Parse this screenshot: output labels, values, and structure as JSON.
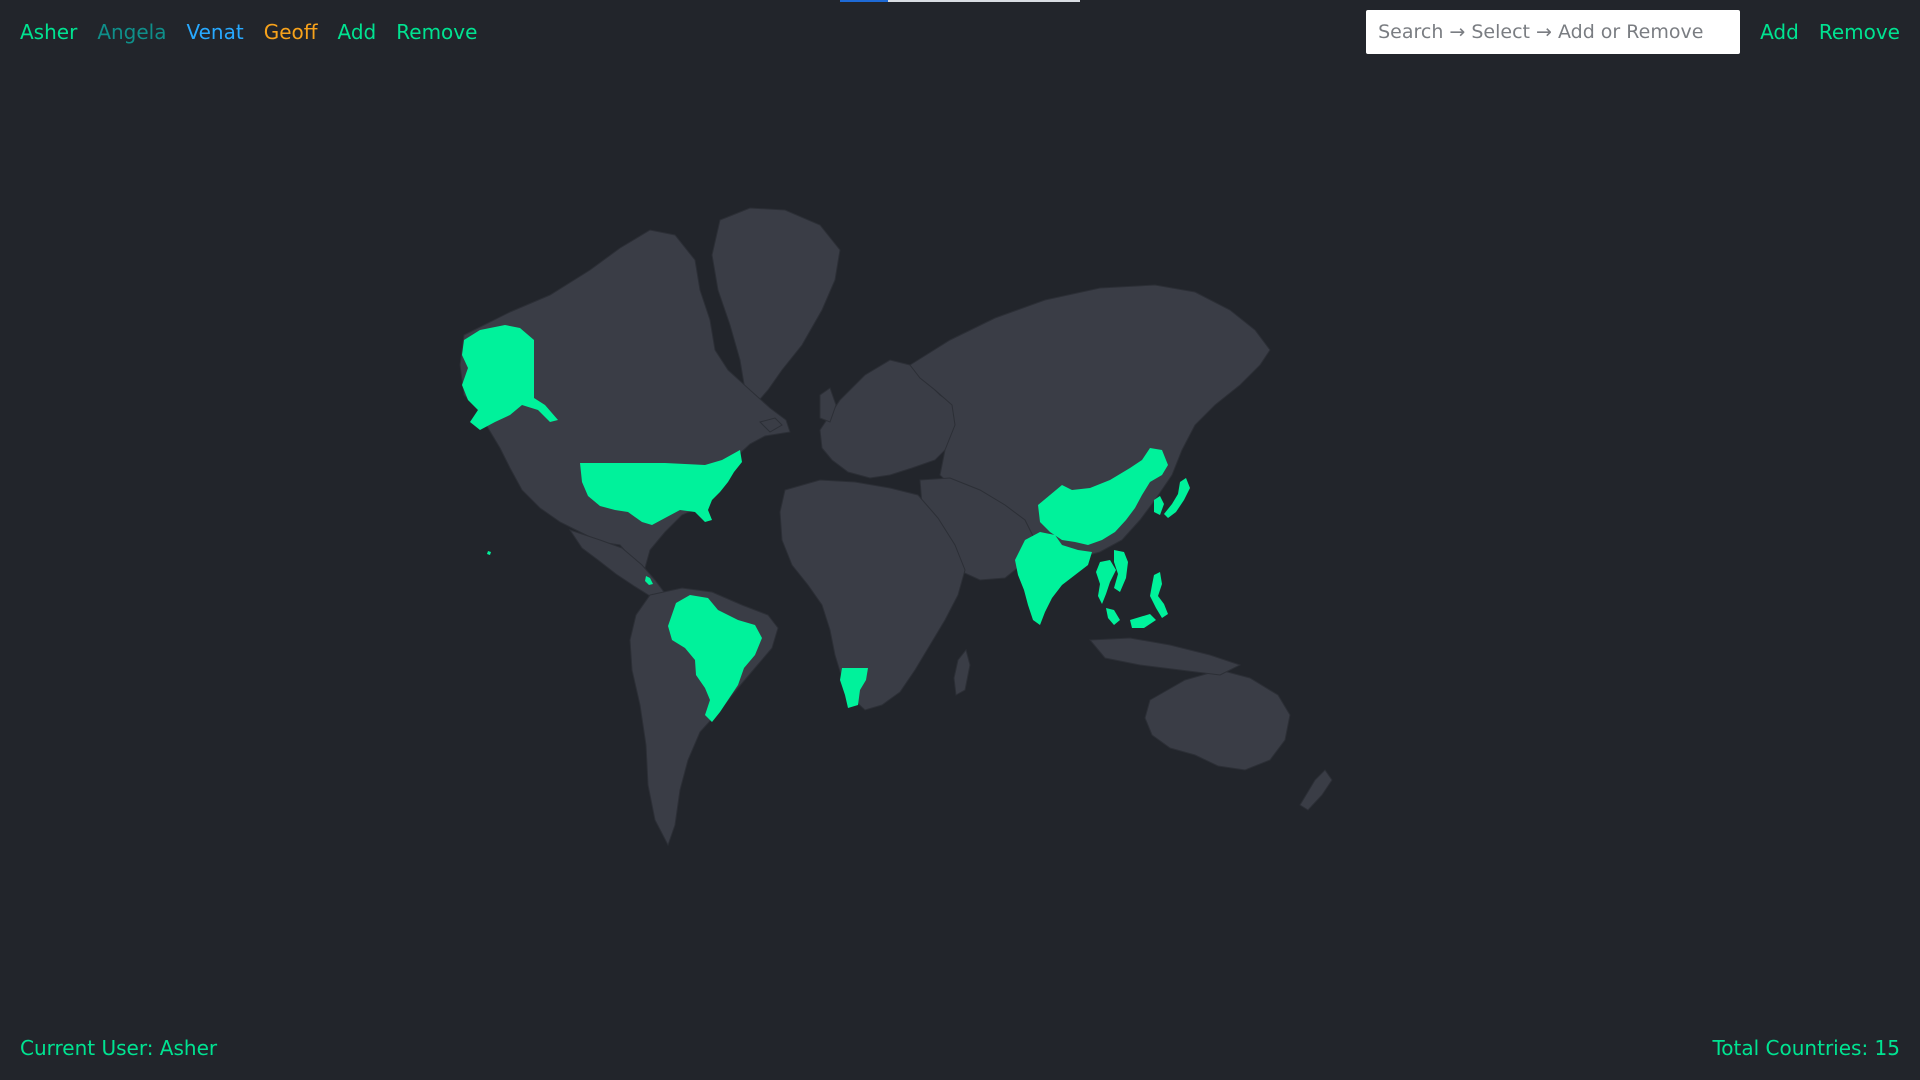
{
  "colors": {
    "background": "#22252b",
    "land": "#3a3d46",
    "visited": "#00f29b",
    "user_asher": "#00e391",
    "user_angela": "#0f8f8a",
    "user_venat": "#27a9ff",
    "user_geoff": "#f7a21b",
    "action": "#00e391"
  },
  "nav": {
    "users": [
      {
        "label": "Asher",
        "color_key": "user_asher",
        "icon": "none"
      },
      {
        "label": "Angela",
        "color_key": "user_angela",
        "icon": "none"
      },
      {
        "label": "Venat",
        "color_key": "user_venat",
        "icon": "none"
      },
      {
        "label": "Geoff",
        "color_key": "user_geoff",
        "icon": "none"
      }
    ],
    "add_label": "Add",
    "remove_label": "Remove"
  },
  "search": {
    "placeholder": "Search → Select → Add or Remove",
    "value": "",
    "add_label": "Add",
    "remove_label": "Remove"
  },
  "map": {
    "highlighted_regions": [
      "United States",
      "Brazil",
      "Namibia",
      "India",
      "China",
      "Japan",
      "South Korea",
      "Thailand",
      "Vietnam",
      "Malaysia",
      "Philippines",
      "Costa Rica"
    ]
  },
  "footer": {
    "current_user_text": "Current User: Asher",
    "total_countries_text": "Total Countries: 15"
  }
}
